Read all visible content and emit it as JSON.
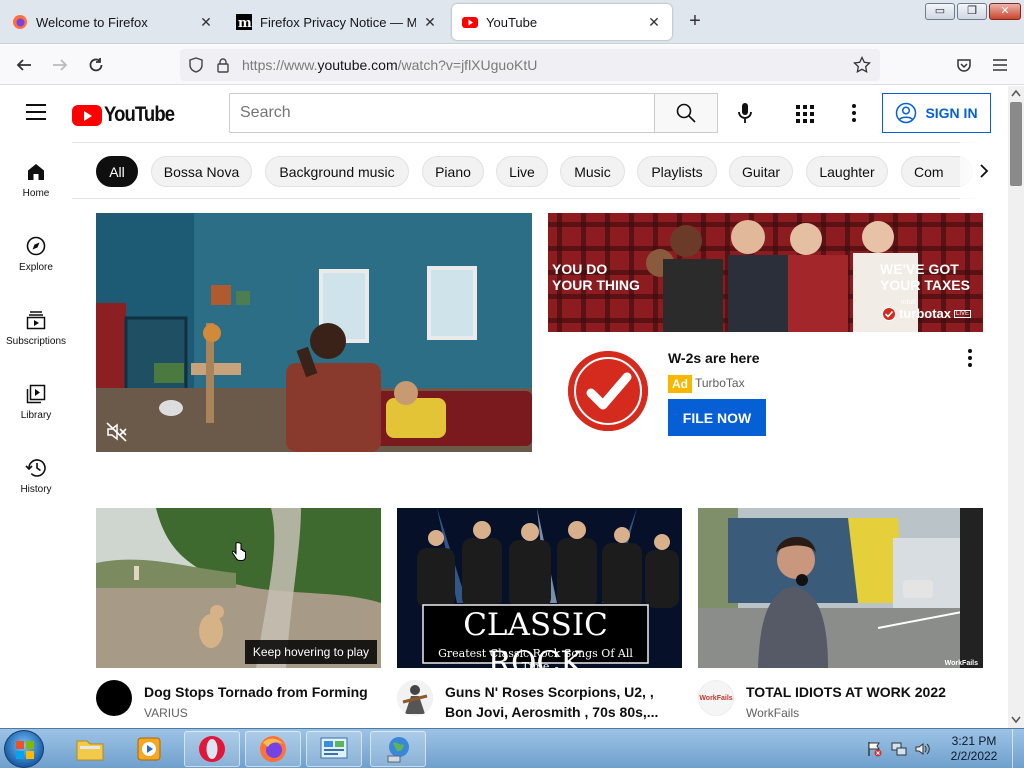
{
  "browser": {
    "tabs": [
      {
        "title": "Welcome to Firefox",
        "favicon": "firefox-icon"
      },
      {
        "title": "Firefox Privacy Notice — Mozilla",
        "favicon": "mozilla-m-icon"
      },
      {
        "title": "YouTube",
        "favicon": "youtube-icon",
        "active": true
      }
    ],
    "url_prefix": "https://www.",
    "url_domain": "youtube.com",
    "url_path": "/watch?v=jflXUguoKtU",
    "window_controls": {
      "minimize": "▭",
      "maximize": "❐",
      "close": "✕"
    }
  },
  "youtube": {
    "logo_text": "YouTube",
    "search_placeholder": "Search",
    "sign_in": "SIGN IN",
    "sidebar": [
      {
        "label": "Home",
        "icon": "home-icon"
      },
      {
        "label": "Explore",
        "icon": "compass-icon"
      },
      {
        "label": "Subscriptions",
        "icon": "subscriptions-icon"
      },
      {
        "label": "Library",
        "icon": "library-icon"
      },
      {
        "label": "History",
        "icon": "history-icon"
      }
    ],
    "chips": [
      "All",
      "Bossa Nova",
      "Background music",
      "Piano",
      "Live",
      "Music",
      "Playlists",
      "Guitar",
      "Laughter",
      "Com"
    ],
    "ad": {
      "banner_left": "YOU DO\nYOUR THING",
      "banner_left_1": "YOU DO",
      "banner_left_2": "YOUR THING",
      "banner_right_1": "WE'VE GOT",
      "banner_right_2": "YOUR TAXES",
      "banner_brand_small": "intuit",
      "banner_brand": "turbotax",
      "banner_brand_tag": "LIVE",
      "title": "W-2s are here",
      "badge": "Ad",
      "advertiser": "TurboTax",
      "cta": "FILE NOW"
    },
    "videos": [
      {
        "title": "Dog Stops Tornado from Forming",
        "channel": "VARIUS",
        "overlay": "Keep hovering to play"
      },
      {
        "title_line1": "Guns N' Roses Scorpions, U2, ,",
        "title_line2": "Bon Jovi, Aerosmith , 70s 80s,...",
        "thumb_title": "CLASSIC ROCK",
        "thumb_subtitle": "Greatest Classic Rock Songs Of All Time"
      },
      {
        "title": "TOTAL IDIOTS AT WORK 2022",
        "channel": "WorkFails",
        "thumb_watermark": "WorkFails",
        "avatar_text": "WorkFails"
      }
    ]
  },
  "taskbar": {
    "time": "3:21 PM",
    "date": "2/2/2022"
  },
  "colors": {
    "youtube_red": "#ff0000",
    "signin_blue": "#065fd4",
    "ad_yellow": "#f9b800",
    "turbotax_red": "#d52b1e"
  }
}
